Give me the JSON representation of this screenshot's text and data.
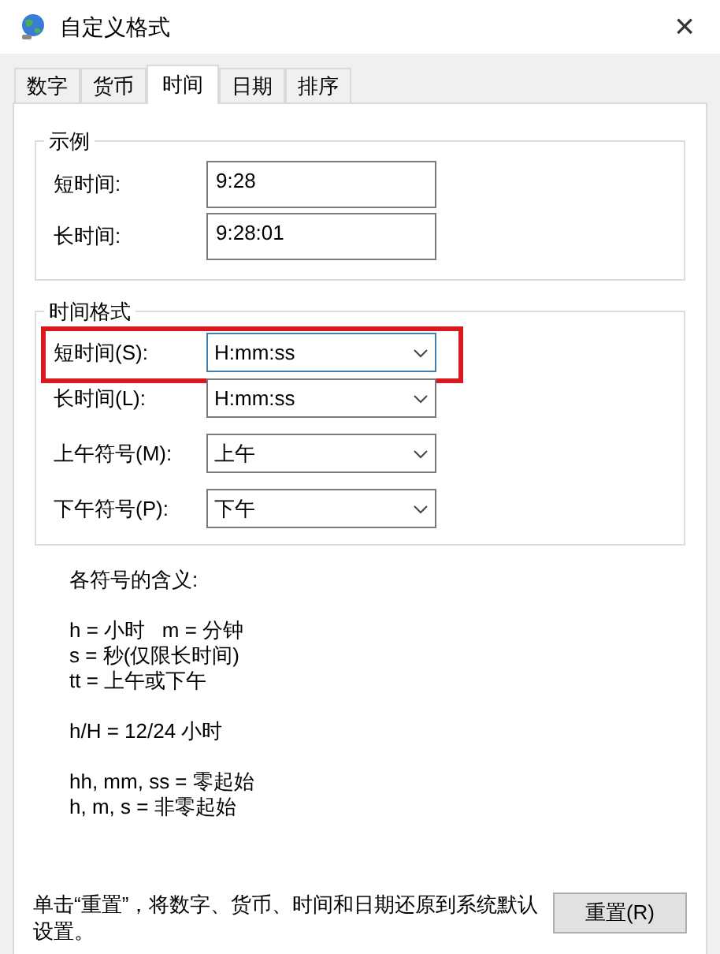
{
  "window": {
    "title": "自定义格式",
    "close": "×"
  },
  "tabs": [
    {
      "label": "数字",
      "selected": false
    },
    {
      "label": "货币",
      "selected": false
    },
    {
      "label": "时间",
      "selected": true
    },
    {
      "label": "日期",
      "selected": false
    },
    {
      "label": "排序",
      "selected": false
    }
  ],
  "example_group": {
    "title": "示例",
    "rows": [
      {
        "label": "短时间:",
        "value": "9:28"
      },
      {
        "label": "长时间:",
        "value": "9:28:01"
      }
    ]
  },
  "format_group": {
    "title": "时间格式",
    "rows": [
      {
        "label": "短时间(S):",
        "value": "H:mm:ss",
        "focused": true,
        "highlighted": true
      },
      {
        "label": "长时间(L):",
        "value": "H:mm:ss",
        "focused": false,
        "highlighted": false
      },
      {
        "label": "上午符号(M):",
        "value": "上午",
        "focused": false,
        "highlighted": false
      },
      {
        "label": "下午符号(P):",
        "value": "下午",
        "focused": false,
        "highlighted": false
      }
    ]
  },
  "legend": {
    "title": "各符号的含义:",
    "blocks": [
      [
        "h = 小时   m = 分钟",
        "s = 秒(仅限长时间)",
        "tt = 上午或下午"
      ],
      [
        "h/H = 12/24 小时"
      ],
      [
        "hh, mm, ss = 零起始",
        "h, m, s = 非零起始"
      ]
    ]
  },
  "footer": {
    "note": "单击“重置”，将数字、货币、时间和日期还原到系统默认设置。",
    "reset_button": "重置(R)"
  }
}
